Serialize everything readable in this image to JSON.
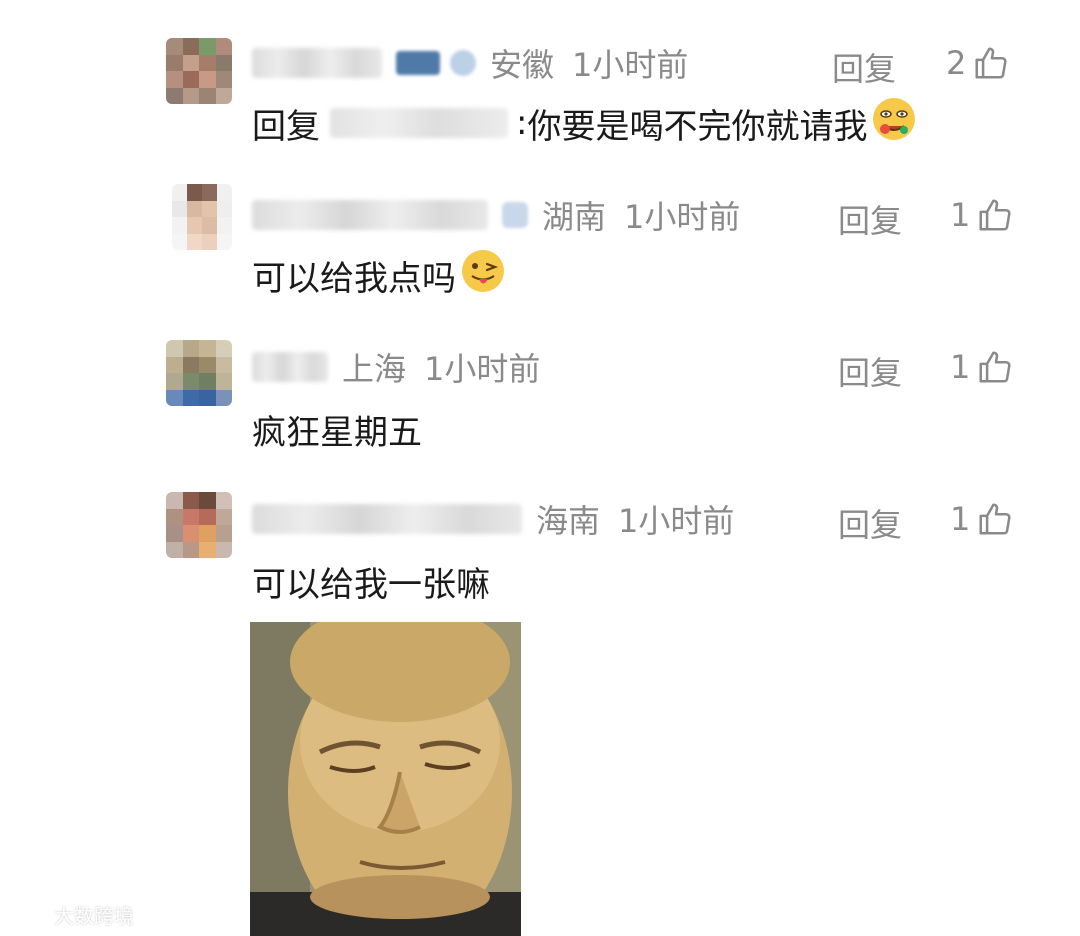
{
  "comments": [
    {
      "location": "安徽",
      "time": "1小时前",
      "reply_label": "回复",
      "likes": "2",
      "text_prefix": "回复",
      "text_colon": ":",
      "text": "你要是喝不完你就请我",
      "emoji": "drooling-face-emoji"
    },
    {
      "location": "湖南",
      "time": "1小时前",
      "reply_label": "回复",
      "likes": "1",
      "text": "可以给我点吗",
      "emoji": "winking-tongue-face-emoji"
    },
    {
      "location": "上海",
      "time": "1小时前",
      "reply_label": "回复",
      "likes": "1",
      "text": "疯狂星期五"
    },
    {
      "location": "海南",
      "time": "1小时前",
      "reply_label": "回复",
      "likes": "1",
      "text": "可以给我一张嘛",
      "has_image": true
    }
  ],
  "watermark": {
    "text": "大数跨境"
  },
  "icons": {
    "like": "thumbs-up-icon"
  },
  "colors": {
    "meta": "#8a8a8a",
    "text": "#1a1a1a",
    "background": "#ffffff"
  }
}
